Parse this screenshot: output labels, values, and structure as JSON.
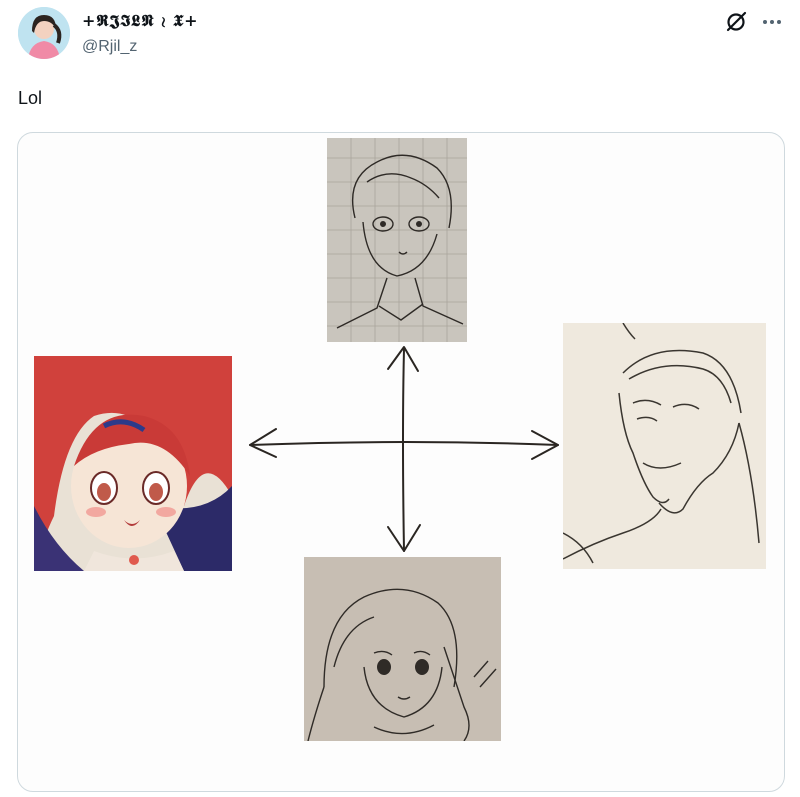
{
  "author": {
    "display_name": "+𝕽𝕵𝕴𝕷𝕹 ≀ 𝖃+",
    "handle": "@Rjil_z"
  },
  "tweet": {
    "text": "Lol"
  },
  "icons": {
    "grok": "grok-icon",
    "more": "more-icon",
    "avatar": "avatar-image"
  },
  "colors": {
    "text_primary": "#0f1419",
    "text_secondary": "#536471",
    "border": "#cfd9de"
  }
}
